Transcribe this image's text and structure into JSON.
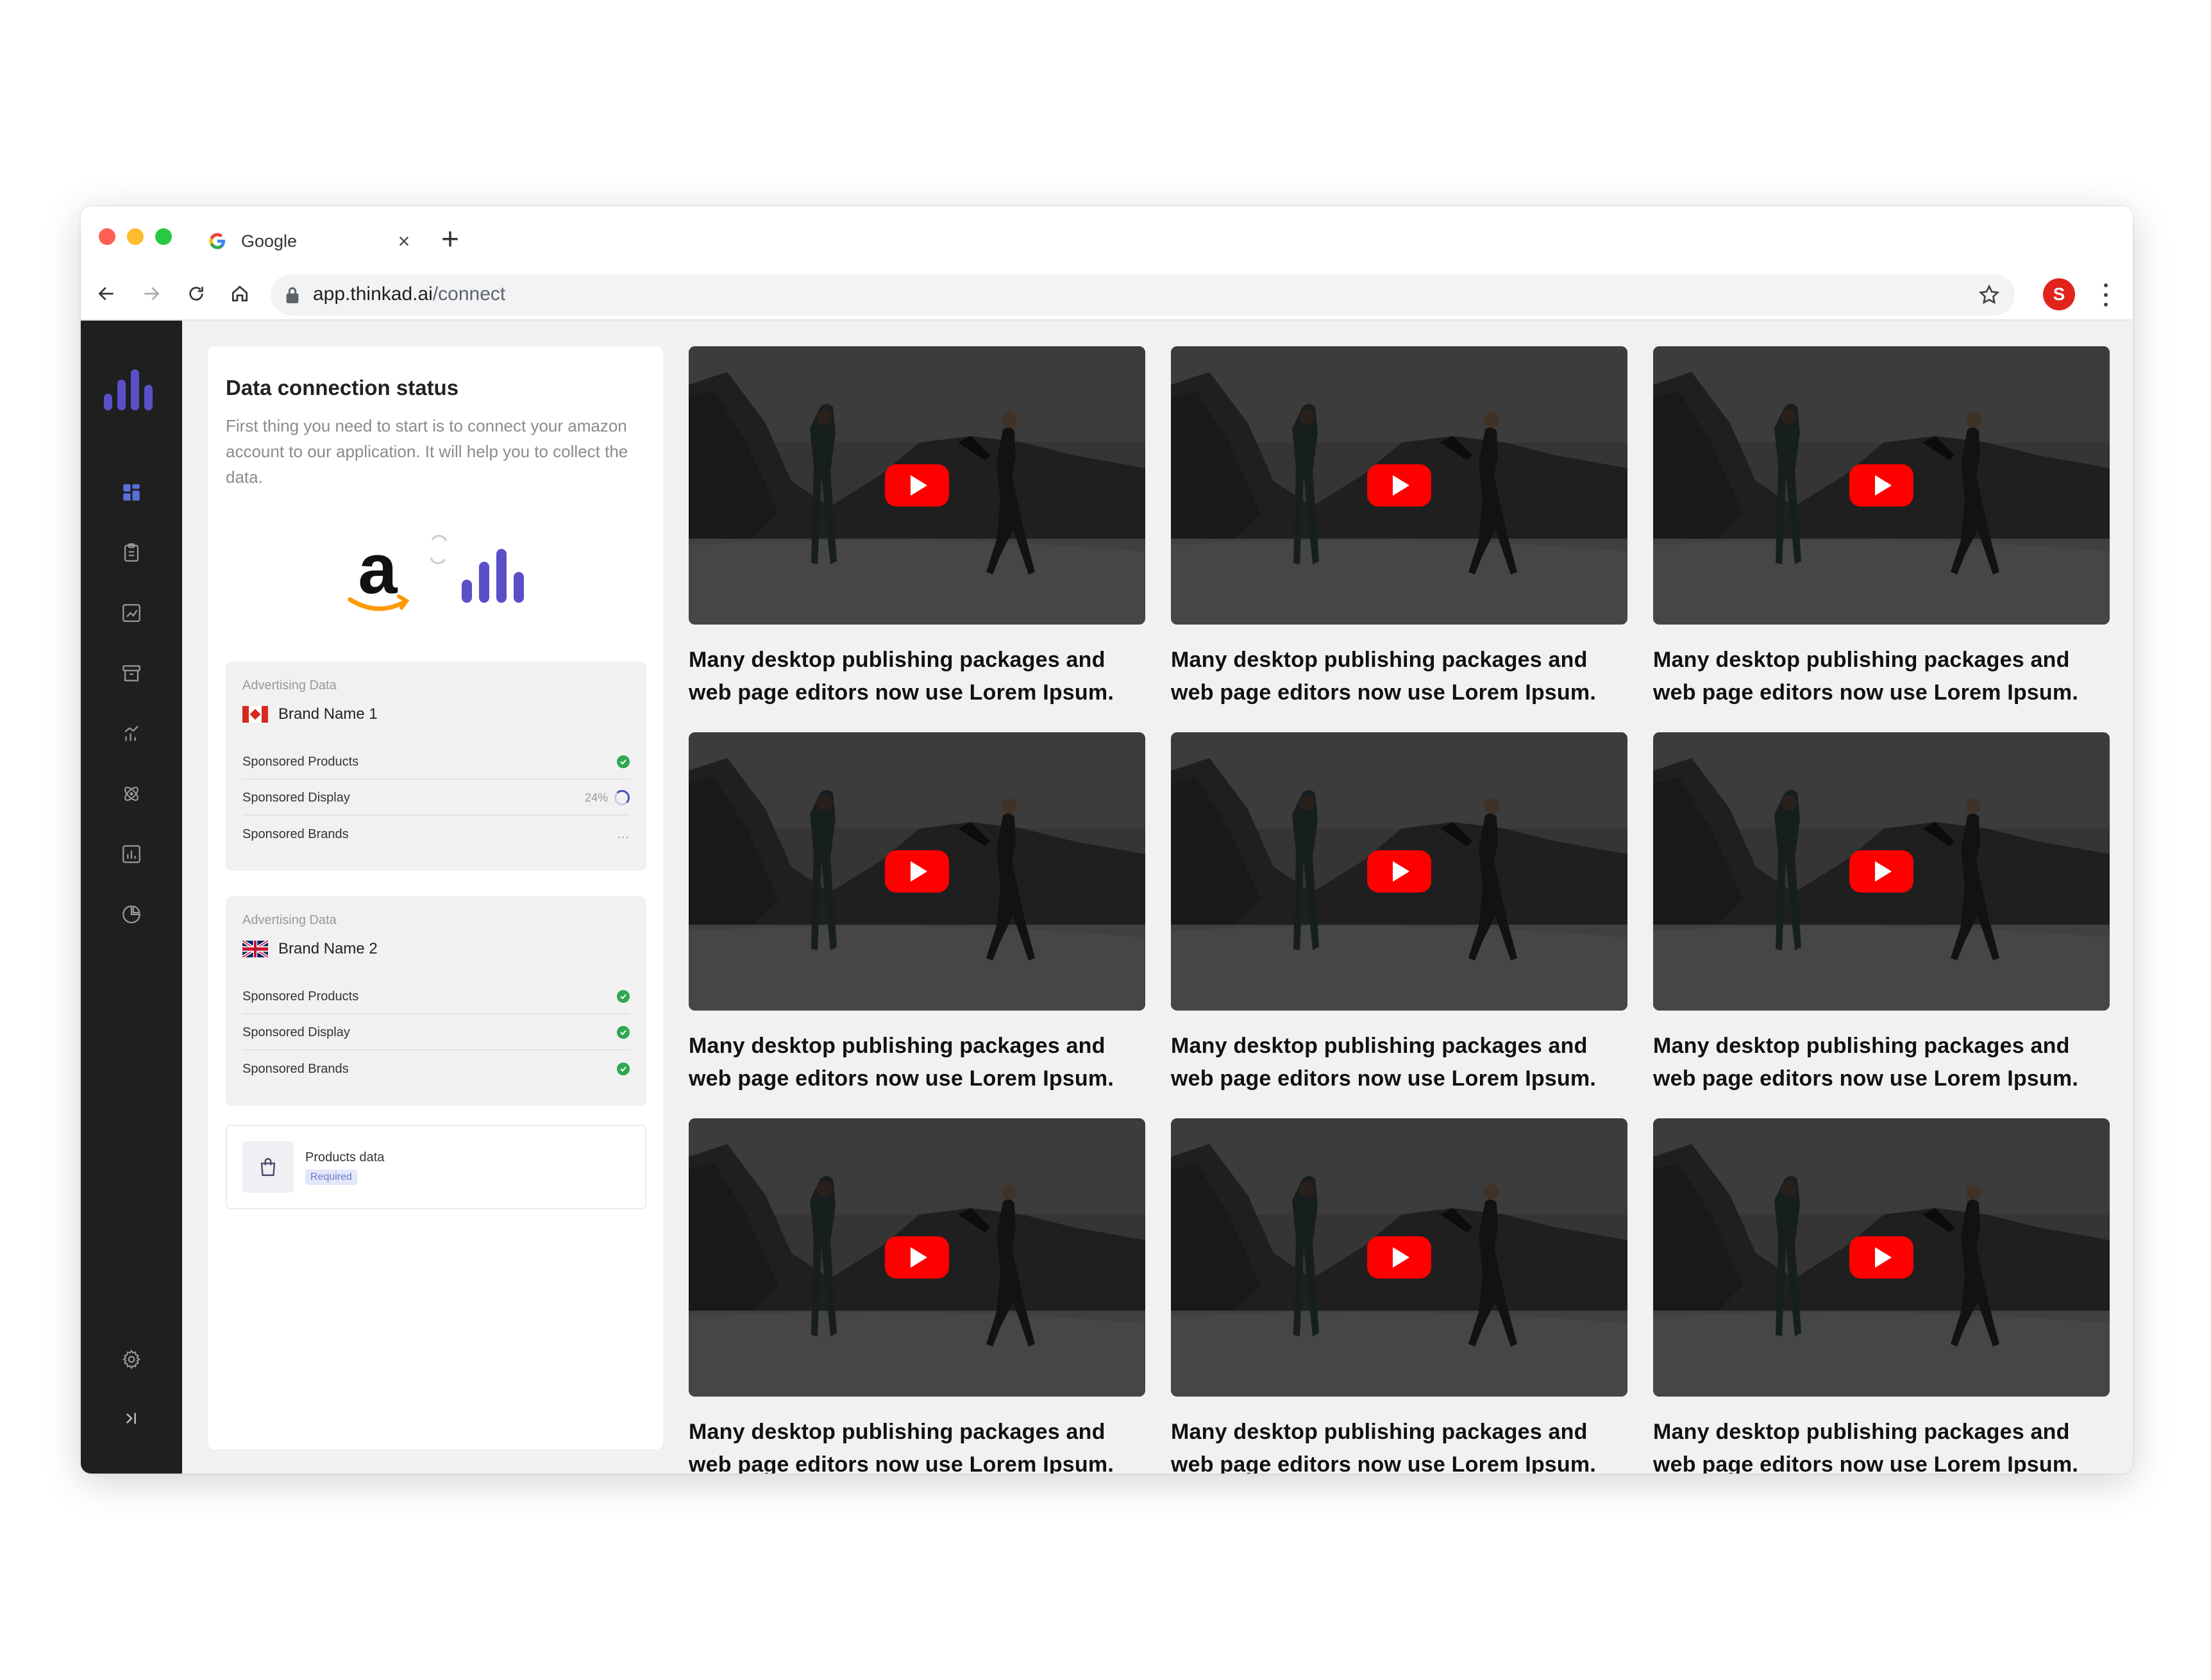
{
  "browser": {
    "tab_title": "Google",
    "close_glyph": "×",
    "new_tab_glyph": "+",
    "url_host": "app.thinkad.ai",
    "url_path": "/connect",
    "profile_initial": "S"
  },
  "sidebar": {
    "items": [
      {
        "icon": "dashboard-icon"
      },
      {
        "icon": "clipboard-icon"
      },
      {
        "icon": "trend-chart-icon"
      },
      {
        "icon": "archive-icon"
      },
      {
        "icon": "growth-icon"
      },
      {
        "icon": "atom-icon"
      },
      {
        "icon": "bar-report-icon"
      },
      {
        "icon": "pie-chart-icon"
      }
    ],
    "bottom": [
      {
        "icon": "gear-icon"
      },
      {
        "icon": "collapse-sidebar-icon"
      }
    ]
  },
  "connection": {
    "title": "Data connection status",
    "description": "First thing you need to start is to connect your amazon account to our application. It will help you to collect the data.",
    "cards": [
      {
        "kicker": "Advertising Data",
        "brand": "Brand Name 1",
        "flag": "canada-flag-icon",
        "rows": [
          {
            "label": "Sponsored Products",
            "status": "done",
            "percent": ""
          },
          {
            "label": "Sponsored Display",
            "status": "loading",
            "percent": "24%"
          },
          {
            "label": "Sponsored Brands",
            "status": "pending",
            "percent": "..."
          }
        ]
      },
      {
        "kicker": "Advertising Data",
        "brand": "Brand Name 2",
        "flag": "uk-flag-icon",
        "rows": [
          {
            "label": "Sponsored Products",
            "status": "done",
            "percent": ""
          },
          {
            "label": "Sponsored Display",
            "status": "done",
            "percent": ""
          },
          {
            "label": "Sponsored Brands",
            "status": "done",
            "percent": ""
          }
        ]
      }
    ],
    "products": {
      "title": "Products data",
      "badge": "Required"
    }
  },
  "videos": [
    {
      "caption": "Many desktop publishing packages and web page editors now use Lorem Ipsum."
    },
    {
      "caption": "Many desktop publishing packages and web page editors now use Lorem Ipsum."
    },
    {
      "caption": "Many desktop publishing packages and web page editors now use Lorem Ipsum."
    },
    {
      "caption": "Many desktop publishing packages and web page editors now use Lorem Ipsum."
    },
    {
      "caption": "Many desktop publishing packages and web page editors now use Lorem Ipsum."
    },
    {
      "caption": "Many desktop publishing packages and web page editors now use Lorem Ipsum."
    },
    {
      "caption": "Many desktop publishing packages and web page editors now use Lorem Ipsum."
    },
    {
      "caption": "Many desktop publishing packages and web page editors now use Lorem Ipsum."
    },
    {
      "caption": "Many desktop publishing packages and web page editors now use Lorem Ipsum."
    }
  ],
  "colors": {
    "brand_purple": "#5b4fc7",
    "sidebar_bg": "#1f1f1f",
    "success_green": "#2fa84f",
    "youtube_red": "#ff0000"
  }
}
